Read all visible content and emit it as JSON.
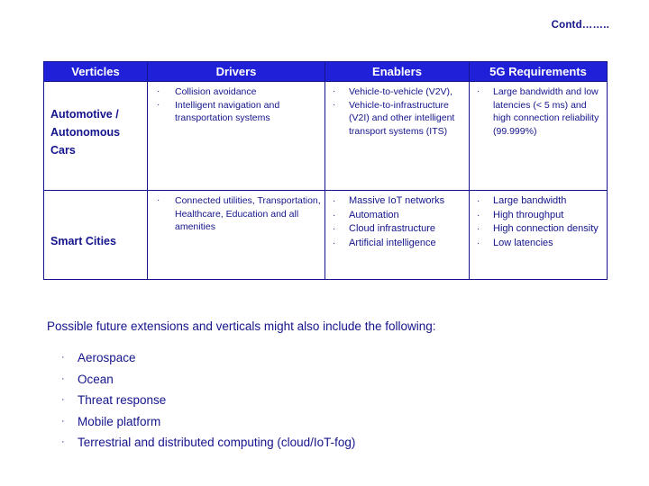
{
  "header_note": "Contd……..",
  "table": {
    "columns": [
      "Verticles",
      "Drivers",
      "Enablers",
      "5G Requirements"
    ],
    "rows": [
      {
        "vertical": "Automotive / Autonomous Cars",
        "drivers": [
          "Collision avoidance",
          "Intelligent navigation and transportation systems"
        ],
        "enablers": [
          "Vehicle-to-vehicle (V2V),",
          "Vehicle-to-infrastructure (V2I) and other intelligent transport systems (ITS)"
        ],
        "requirements": [
          "Large bandwidth and low latencies (< 5 ms) and high connection reliability (99.999%)"
        ]
      },
      {
        "vertical": "Smart Cities",
        "drivers": [
          "Connected utilities, Transportation, Healthcare, Education and all amenities"
        ],
        "enablers": [
          "Massive IoT networks",
          "Automation",
          "Cloud infrastructure",
          "Artificial intelligence"
        ],
        "requirements": [
          "Large bandwidth",
          "High throughput",
          "High connection density",
          "Low latencies"
        ]
      }
    ]
  },
  "footer": {
    "title": "Possible future extensions and verticals might also include the following:",
    "items": [
      "Aerospace",
      "Ocean",
      "Threat response",
      "Mobile platform",
      "Terrestrial and distributed computing (cloud/IoT-fog)"
    ]
  },
  "glyphs": {
    "bullet": "·"
  },
  "colors": {
    "text": "#14148c",
    "header_bg": "#2020d8",
    "header_text": "#ffffff",
    "border": "#14148c"
  }
}
